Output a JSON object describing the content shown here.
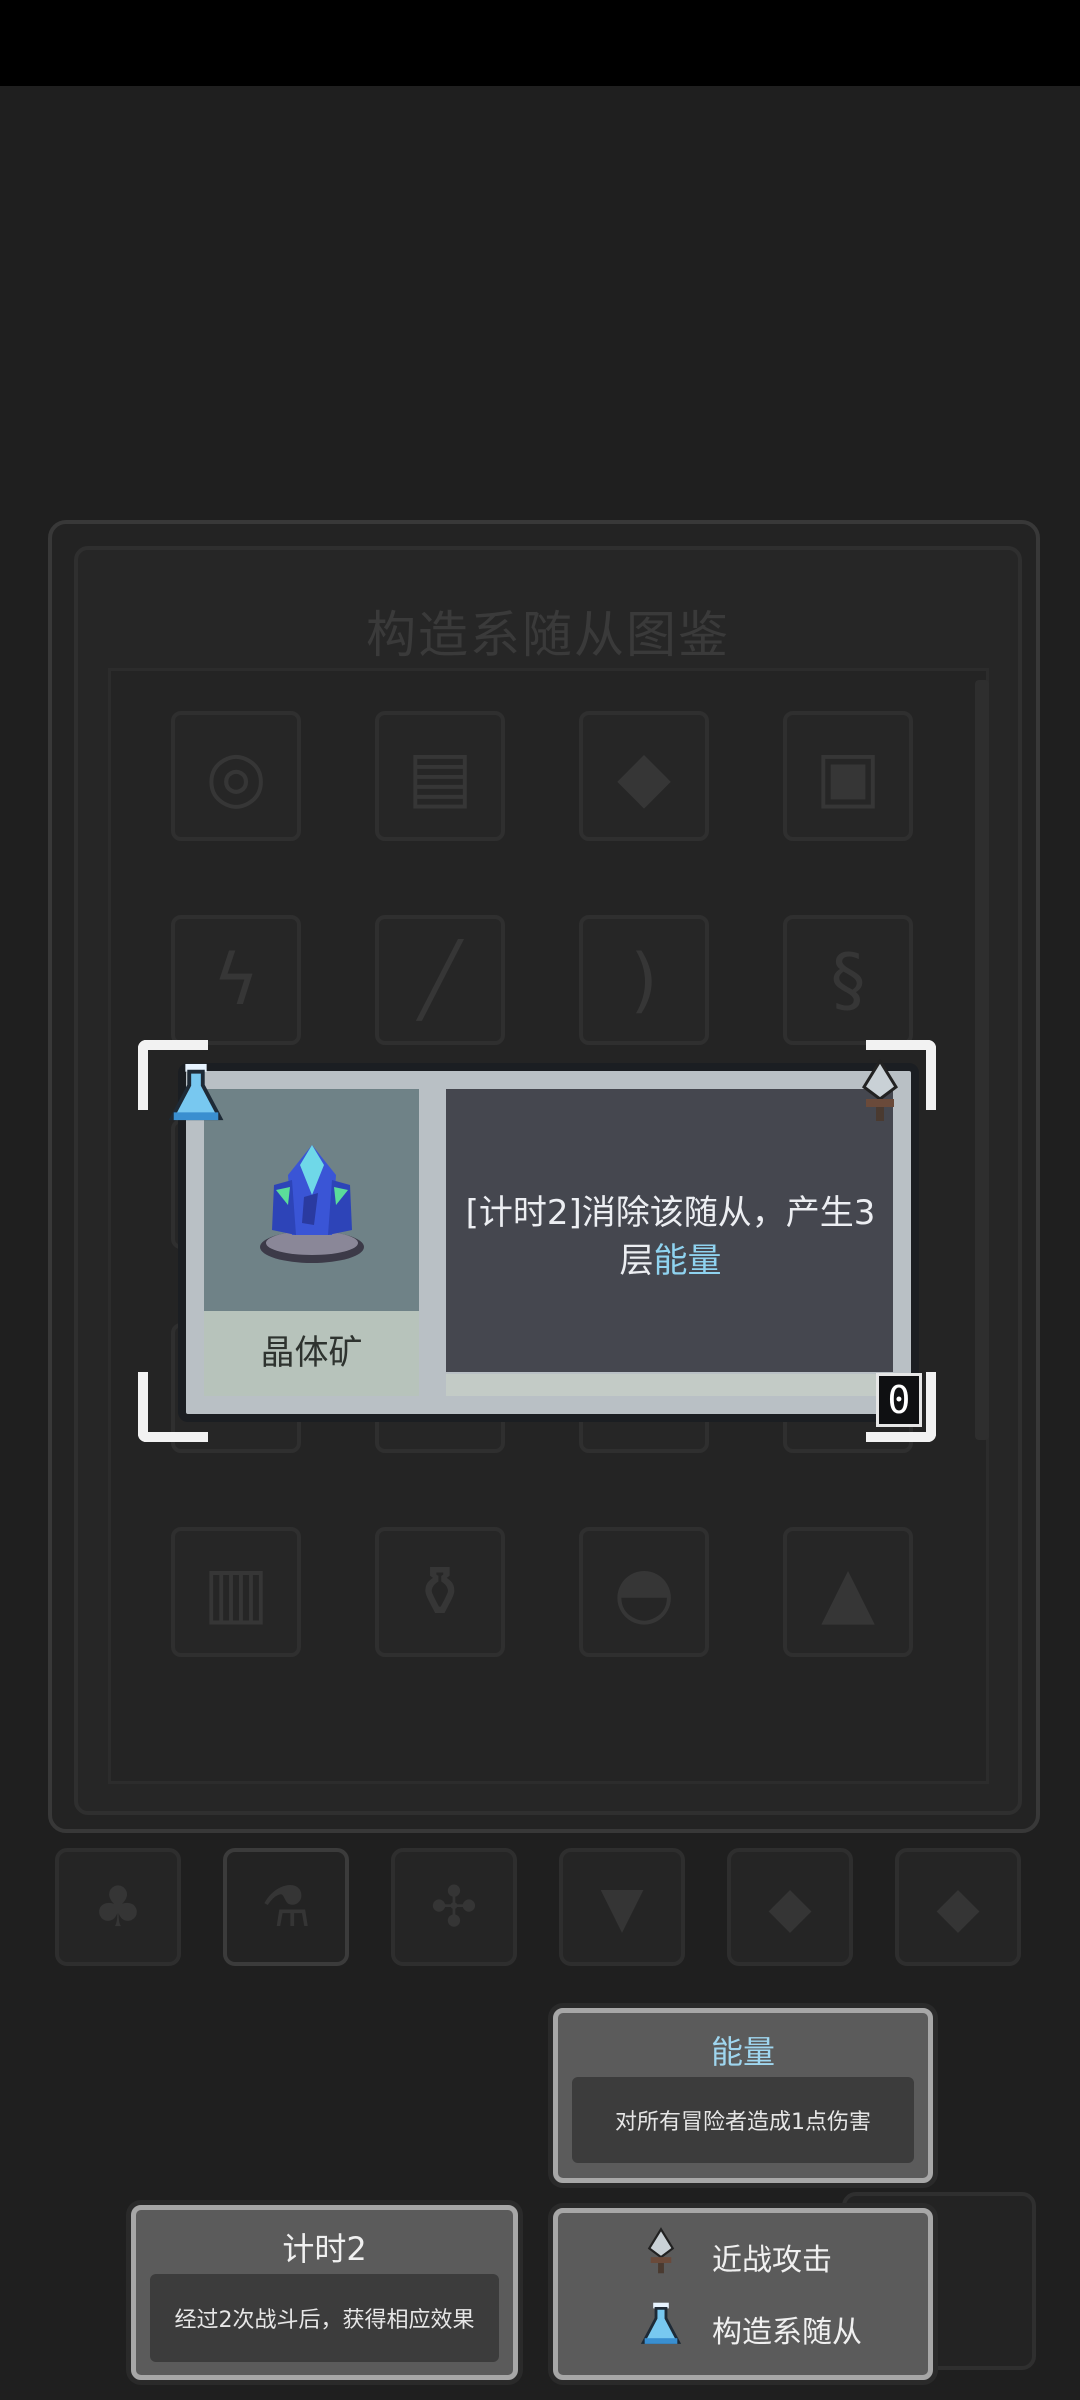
{
  "panel": {
    "title": "构造系随从图鉴",
    "grid_icons": [
      "target-gear-icon",
      "barrel-icon",
      "crystal-cluster-icon",
      "padlock-icon",
      "lightning-bolt-icon",
      "shotgun-icon",
      "scimitar-icon",
      "serpent-staff-icon",
      "gem-icon",
      "crab-icon",
      "plant-icon",
      "chest-icon",
      "angel-knight-icon",
      "golden-beetle-icon",
      "rock-golem-icon",
      "green-eye-icon",
      "box-icon",
      "urn-icon",
      "helmet-icon",
      "fire-icon"
    ]
  },
  "category_tabs": [
    "clover-icon",
    "flask-icon",
    "gear-frame-icon",
    "fox-icon",
    "blue-diamond-icon",
    "purple-diamond-icon"
  ],
  "active_tab_index": 1,
  "card": {
    "name": "晶体矿",
    "description_prefix": "[计时2]消除该随从，产生3层",
    "description_keyword": "能量",
    "counter": "0",
    "top_left_icon": "flask-icon",
    "top_right_icon": "dagger-icon",
    "portrait_icon": "crystal-ore-icon"
  },
  "tooltips": {
    "energy": {
      "title": "能量",
      "body": "对所有冒险者造成1点伤害"
    },
    "timer": {
      "title": "计时2",
      "body": "经过2次战斗后，获得相应效果"
    },
    "tags": [
      {
        "icon": "dagger-icon",
        "label": "近战攻击"
      },
      {
        "icon": "flask-icon",
        "label": "构造系随从"
      }
    ]
  },
  "colors": {
    "keyword": "#8fd3f0",
    "card_frame": "#b9c0c5",
    "description_bg": "#45474f"
  }
}
